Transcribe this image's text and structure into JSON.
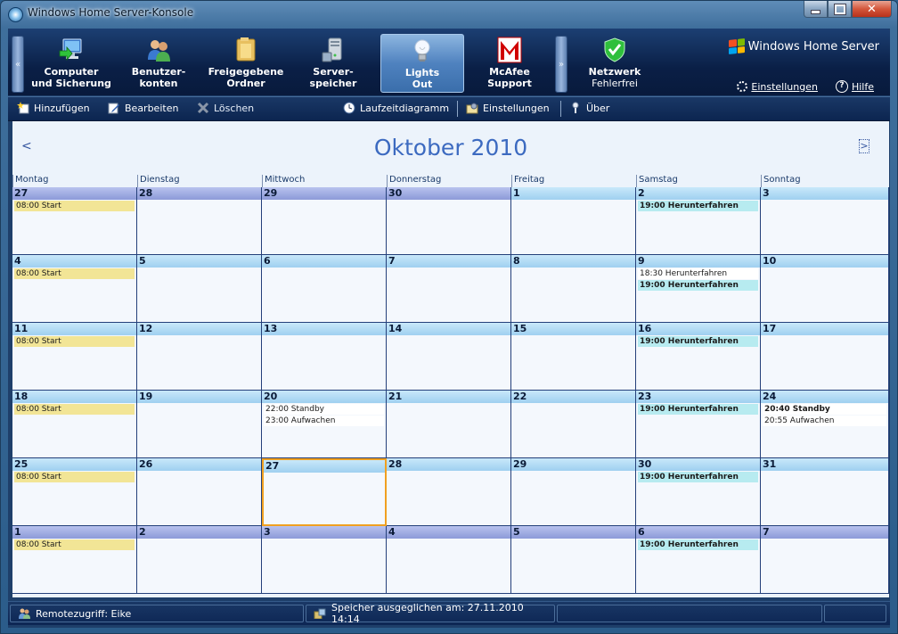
{
  "window": {
    "title": "Windows Home Server-Konsole"
  },
  "nav": {
    "tabs": [
      {
        "line1": "Computer",
        "line2": "und Sicherung",
        "icon": "computer-backup-icon"
      },
      {
        "line1": "Benutzer-",
        "line2": "konten",
        "icon": "users-icon"
      },
      {
        "line1": "Freigegebene",
        "line2": "Ordner",
        "icon": "shared-folders-icon"
      },
      {
        "line1": "Server-",
        "line2": "speicher",
        "icon": "server-storage-icon"
      },
      {
        "line1": "Lights",
        "line2": "Out",
        "icon": "lightbulb-icon",
        "selected": true
      },
      {
        "line1": "McAfee",
        "line2": "Support",
        "icon": "mcafee-icon"
      }
    ],
    "network": {
      "label": "Netzwerk",
      "status": "Fehlerfrei",
      "icon": "network-shield-icon",
      "status_color": "#2fbf3c"
    },
    "brand": "Windows Home Server",
    "links": {
      "settings": "Einstellungen",
      "help": "Hilfe"
    }
  },
  "toolbar": {
    "add": "Hinzufügen",
    "edit": "Bearbeiten",
    "delete": "Löschen",
    "runtime_chart": "Laufzeitdiagramm",
    "settings": "Einstellungen",
    "about": "Über"
  },
  "calendar": {
    "title": "Oktober 2010",
    "prev": "<",
    "next": ">",
    "weekdays": [
      "Montag",
      "Dienstag",
      "Mittwoch",
      "Donnerstag",
      "Freitag",
      "Samstag",
      "Sonntag"
    ],
    "weeks": [
      [
        {
          "day": "27",
          "cur": false,
          "events": [
            {
              "text": "08:00 Start",
              "kind": "start"
            }
          ]
        },
        {
          "day": "28",
          "cur": false,
          "events": []
        },
        {
          "day": "29",
          "cur": false,
          "events": []
        },
        {
          "day": "30",
          "cur": false,
          "events": []
        },
        {
          "day": "1",
          "cur": true,
          "events": []
        },
        {
          "day": "2",
          "cur": true,
          "events": [
            {
              "text": "19:00 Herunterfahren",
              "kind": "shut"
            }
          ]
        },
        {
          "day": "3",
          "cur": true,
          "events": []
        }
      ],
      [
        {
          "day": "4",
          "cur": true,
          "events": [
            {
              "text": "08:00 Start",
              "kind": "start"
            }
          ]
        },
        {
          "day": "5",
          "cur": true,
          "events": []
        },
        {
          "day": "6",
          "cur": true,
          "events": []
        },
        {
          "day": "7",
          "cur": true,
          "events": []
        },
        {
          "day": "8",
          "cur": true,
          "events": []
        },
        {
          "day": "9",
          "cur": true,
          "events": [
            {
              "text": "18:30 Herunterfahren",
              "kind": "plain"
            },
            {
              "text": "19:00 Herunterfahren",
              "kind": "shut"
            }
          ]
        },
        {
          "day": "10",
          "cur": true,
          "events": []
        }
      ],
      [
        {
          "day": "11",
          "cur": true,
          "events": [
            {
              "text": "08:00 Start",
              "kind": "start"
            }
          ]
        },
        {
          "day": "12",
          "cur": true,
          "events": []
        },
        {
          "day": "13",
          "cur": true,
          "events": []
        },
        {
          "day": "14",
          "cur": true,
          "events": []
        },
        {
          "day": "15",
          "cur": true,
          "events": []
        },
        {
          "day": "16",
          "cur": true,
          "events": [
            {
              "text": "19:00 Herunterfahren",
              "kind": "shut"
            }
          ]
        },
        {
          "day": "17",
          "cur": true,
          "events": []
        }
      ],
      [
        {
          "day": "18",
          "cur": true,
          "events": [
            {
              "text": "08:00 Start",
              "kind": "start"
            }
          ]
        },
        {
          "day": "19",
          "cur": true,
          "events": []
        },
        {
          "day": "20",
          "cur": true,
          "events": [
            {
              "text": "22:00 Standby",
              "kind": "plain"
            },
            {
              "text": "23:00 Aufwachen",
              "kind": "plain"
            }
          ]
        },
        {
          "day": "21",
          "cur": true,
          "events": []
        },
        {
          "day": "22",
          "cur": true,
          "events": []
        },
        {
          "day": "23",
          "cur": true,
          "events": [
            {
              "text": "19:00 Herunterfahren",
              "kind": "shut"
            }
          ]
        },
        {
          "day": "24",
          "cur": true,
          "events": [
            {
              "text": "20:40 Standby",
              "kind": "plainbold"
            },
            {
              "text": "20:55 Aufwachen",
              "kind": "plain"
            }
          ]
        }
      ],
      [
        {
          "day": "25",
          "cur": true,
          "events": [
            {
              "text": "08:00 Start",
              "kind": "start"
            }
          ]
        },
        {
          "day": "26",
          "cur": true,
          "events": []
        },
        {
          "day": "27",
          "cur": true,
          "today": true,
          "events": []
        },
        {
          "day": "28",
          "cur": true,
          "events": []
        },
        {
          "day": "29",
          "cur": true,
          "events": []
        },
        {
          "day": "30",
          "cur": true,
          "events": [
            {
              "text": "19:00 Herunterfahren",
              "kind": "shut"
            }
          ]
        },
        {
          "day": "31",
          "cur": true,
          "events": []
        }
      ],
      [
        {
          "day": "1",
          "cur": false,
          "events": [
            {
              "text": "08:00 Start",
              "kind": "start"
            }
          ]
        },
        {
          "day": "2",
          "cur": false,
          "events": []
        },
        {
          "day": "3",
          "cur": false,
          "events": []
        },
        {
          "day": "4",
          "cur": false,
          "events": []
        },
        {
          "day": "5",
          "cur": false,
          "events": []
        },
        {
          "day": "6",
          "cur": false,
          "events": [
            {
              "text": "19:00 Herunterfahren",
              "kind": "shut"
            }
          ]
        },
        {
          "day": "7",
          "cur": false,
          "events": []
        }
      ]
    ]
  },
  "status": {
    "remote": "Remotezugriff: Eike",
    "storage": "Speicher ausgeglichen am: 27.11.2010 14:14"
  },
  "colors": {
    "accent": "#3c6ac0",
    "start_event": "#f2e596",
    "shutdown_event": "#b7ebf0",
    "today_outline": "#f0a020"
  }
}
